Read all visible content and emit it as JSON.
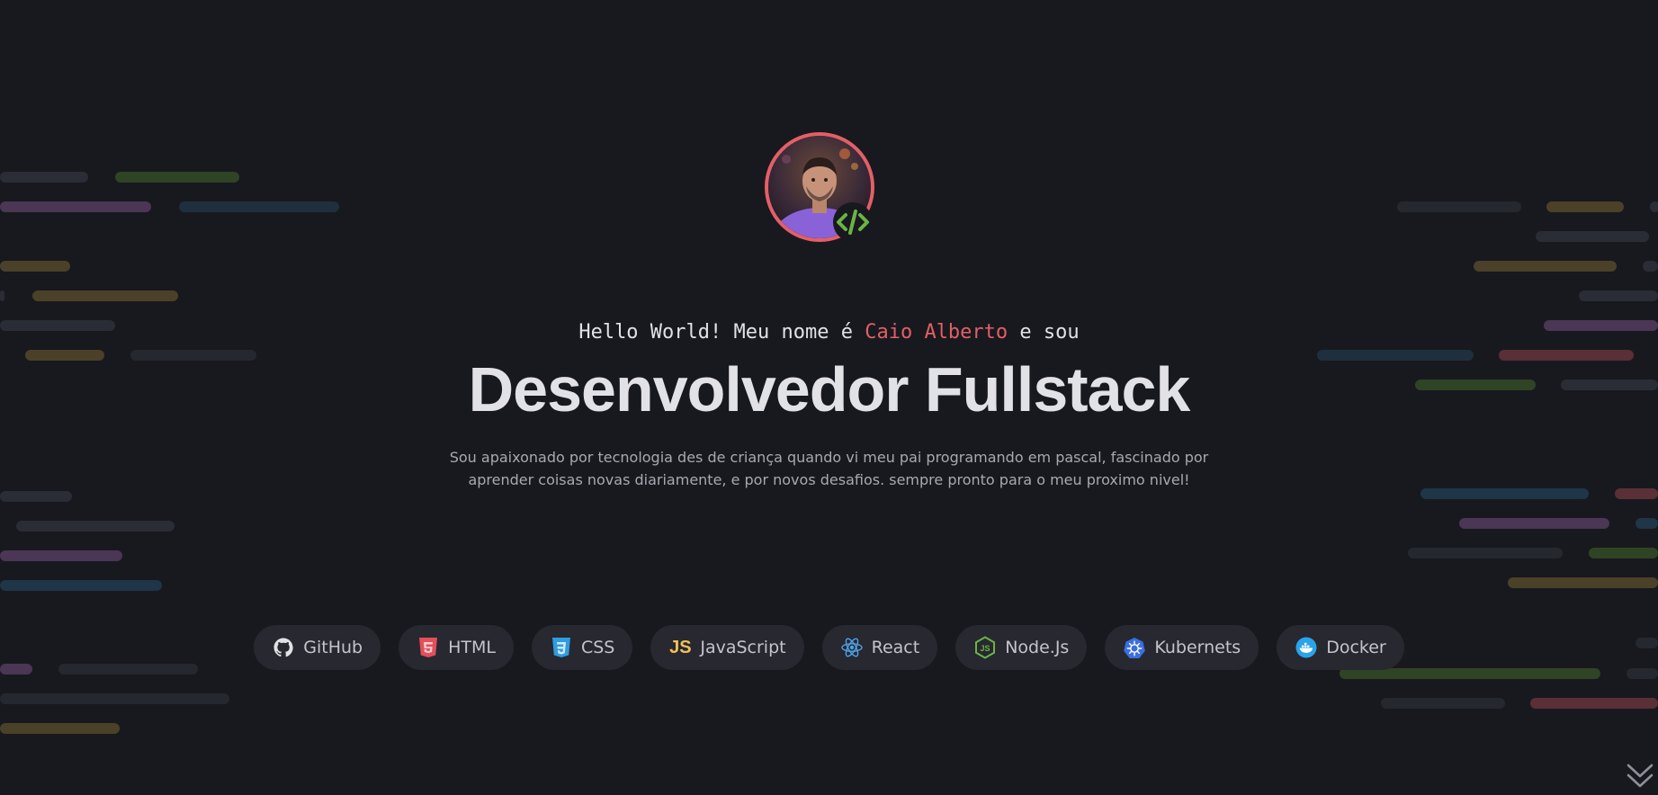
{
  "hero": {
    "greeting_prefix": "Hello World! Meu nome é",
    "name": "Caio Alberto",
    "greeting_suffix": "e sou",
    "title": "Desenvolvedor Fullstack",
    "description": "Sou apaixonado por tecnologia des de criança quando vi meu pai programando em pascal, fascinado por aprender coisas novas diariamente, e por novos desafios. sempre pronto para o meu proximo nivel!"
  },
  "techs": [
    {
      "label": "GitHub",
      "icon": "github-icon",
      "color": "#e1e1e6"
    },
    {
      "label": "HTML",
      "icon": "html5-icon",
      "color": "#e34f5a"
    },
    {
      "label": "CSS",
      "icon": "css3-icon",
      "color": "#2f9ce0"
    },
    {
      "label": "JavaScript",
      "icon": "javascript-icon",
      "color": "#f0c05a"
    },
    {
      "label": "React",
      "icon": "react-icon",
      "color": "#4fa3e8"
    },
    {
      "label": "Node.Js",
      "icon": "nodejs-icon",
      "color": "#6bb344"
    },
    {
      "label": "Kubernets",
      "icon": "kubernetes-icon",
      "color": "#3b6fe0"
    },
    {
      "label": "Docker",
      "icon": "docker-icon",
      "color": "#2aa4e8"
    }
  ],
  "colors": {
    "background": "#18191e",
    "accent": "#e35f67",
    "text": "#e1e1e6",
    "muted": "#a8a8b3",
    "chip": "#272830"
  }
}
